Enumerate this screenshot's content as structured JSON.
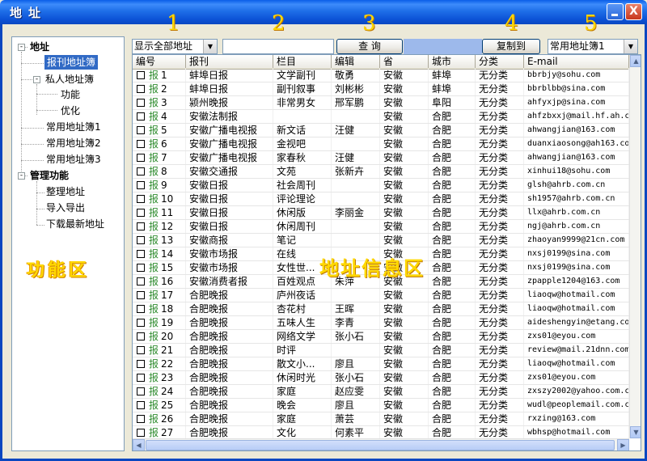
{
  "window": {
    "title": "地址",
    "close_glyph": "X"
  },
  "sidebar": {
    "items": [
      {
        "label": "地址"
      },
      {
        "label": "报刊地址簿"
      },
      {
        "label": "私人地址簿"
      },
      {
        "label": "功能"
      },
      {
        "label": "优化"
      },
      {
        "label": "常用地址簿1"
      },
      {
        "label": "常用地址簿2"
      },
      {
        "label": "常用地址簿3"
      },
      {
        "label": "管理功能"
      },
      {
        "label": "整理地址"
      },
      {
        "label": "导入导出"
      },
      {
        "label": "下载最新地址"
      }
    ]
  },
  "annotations": {
    "functional_area": "功能区",
    "address_info_area": "地址信息区",
    "numbers": [
      "1",
      "2",
      "3",
      "4",
      "5"
    ]
  },
  "toolbar": {
    "filter_select": "显示全部地址",
    "search_value": "",
    "query_button": "查 询",
    "copy_button": "复制到",
    "target_select": "常用地址簿1"
  },
  "table": {
    "columns": [
      "编号",
      "报刊",
      "栏目",
      "编辑",
      "省",
      "城市",
      "分类",
      "E-mail"
    ],
    "row_tag": "报",
    "rows": [
      [
        "1",
        "蚌埠日报",
        "文学副刊",
        "敬勇",
        "安徽",
        "蚌埠",
        "无分类",
        "bbrbjy@sohu.com"
      ],
      [
        "2",
        "蚌埠日报",
        "副刊叙事",
        "刘彬彬",
        "安徽",
        "蚌埠",
        "无分类",
        "bbrblbb@sina.com"
      ],
      [
        "3",
        "颍州晚报",
        "非常男女",
        "邢军鹏",
        "安徽",
        "阜阳",
        "无分类",
        "ahfyxjp@sina.com"
      ],
      [
        "4",
        "安徽法制报",
        "",
        "",
        "安徽",
        "合肥",
        "无分类",
        "ahfzbxxj@mail.hf.ah.c"
      ],
      [
        "5",
        "安徽广播电视报",
        "新文话",
        "汪健",
        "安徽",
        "合肥",
        "无分类",
        "ahwangjian@163.com"
      ],
      [
        "6",
        "安徽广播电视报",
        "金视吧",
        "",
        "安徽",
        "合肥",
        "无分类",
        "duanxiaosong@ah163.co"
      ],
      [
        "7",
        "安徽广播电视报",
        "家春秋",
        "汪健",
        "安徽",
        "合肥",
        "无分类",
        "ahwangjian@163.com"
      ],
      [
        "8",
        "安徽交通报",
        "文苑",
        "张新卉",
        "安徽",
        "合肥",
        "无分类",
        "xinhui18@sohu.com"
      ],
      [
        "9",
        "安徽日报",
        "社会周刊",
        "",
        "安徽",
        "合肥",
        "无分类",
        "glsh@ahrb.com.cn"
      ],
      [
        "10",
        "安徽日报",
        "评论理论",
        "",
        "安徽",
        "合肥",
        "无分类",
        "sh1957@ahrb.com.cn"
      ],
      [
        "11",
        "安徽日报",
        "休闲版",
        "李丽金",
        "安徽",
        "合肥",
        "无分类",
        "llx@ahrb.com.cn"
      ],
      [
        "12",
        "安徽日报",
        "休闲周刊",
        "",
        "安徽",
        "合肥",
        "无分类",
        "ngj@ahrb.com.cn"
      ],
      [
        "13",
        "安徽商报",
        "笔记",
        "",
        "安徽",
        "合肥",
        "无分类",
        "zhaoyan9999@21cn.com"
      ],
      [
        "14",
        "安徽市场报",
        "在线",
        "",
        "安徽",
        "合肥",
        "无分类",
        "nxsj0199@sina.com"
      ],
      [
        "15",
        "安徽市场报",
        "女性世...",
        "",
        "安徽",
        "合肥",
        "无分类",
        "nxsj0199@sina.com"
      ],
      [
        "16",
        "安徽消费者报",
        "百姓观点",
        "朱萍",
        "安徽",
        "合肥",
        "无分类",
        "zpapple1204@163.com"
      ],
      [
        "17",
        "合肥晚报",
        "庐州夜话",
        "",
        "安徽",
        "合肥",
        "无分类",
        "liaoqw@hotmail.com"
      ],
      [
        "18",
        "合肥晚报",
        "杏花村",
        "王晖",
        "安徽",
        "合肥",
        "无分类",
        "liaoqw@hotmail.com"
      ],
      [
        "19",
        "合肥晚报",
        "五味人生",
        "李青",
        "安徽",
        "合肥",
        "无分类",
        "aideshengyin@etang.co"
      ],
      [
        "20",
        "合肥晚报",
        "网络文学",
        "张小石",
        "安徽",
        "合肥",
        "无分类",
        "zxs01@eyou.com"
      ],
      [
        "21",
        "合肥晚报",
        "时评",
        "",
        "安徽",
        "合肥",
        "无分类",
        "review@mail.21dnn.com"
      ],
      [
        "22",
        "合肥晚报",
        "散文小...",
        "廖且",
        "安徽",
        "合肥",
        "无分类",
        "liaoqw@hotmail.com"
      ],
      [
        "23",
        "合肥晚报",
        "休闲时光",
        "张小石",
        "安徽",
        "合肥",
        "无分类",
        "zxs01@eyou.com"
      ],
      [
        "24",
        "合肥晚报",
        "家庭",
        "赵应雯",
        "安徽",
        "合肥",
        "无分类",
        "zxszy2002@yahoo.com.cn"
      ],
      [
        "25",
        "合肥晚报",
        "晚会",
        "廖且",
        "安徽",
        "合肥",
        "无分类",
        "wudl@peoplemail.com.c"
      ],
      [
        "26",
        "合肥晚报",
        "家庭",
        "萧芸",
        "安徽",
        "合肥",
        "无分类",
        "rxzing@163.com"
      ],
      [
        "27",
        "合肥晚报",
        "文化",
        "何素平",
        "安徽",
        "合肥",
        "无分类",
        "wbhsp@hotmail.com"
      ]
    ]
  },
  "colors": {
    "title_bar": "#0A5EE8",
    "selection": "#316AC5",
    "annotation": "#FFD800"
  },
  "icons": [
    "minimize-icon",
    "close-icon",
    "dropdown-arrow-icon",
    "checkbox-icon",
    "scroll-up-icon",
    "scroll-down-icon",
    "scroll-left-icon",
    "scroll-right-icon"
  ]
}
